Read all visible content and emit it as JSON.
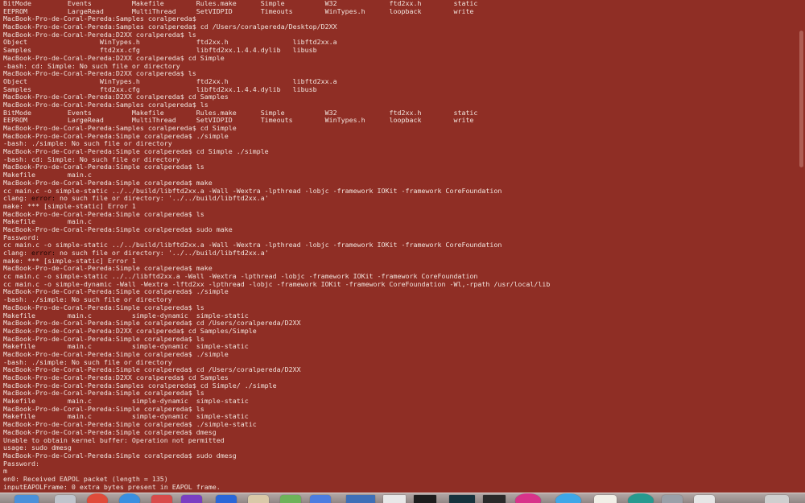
{
  "terminal": {
    "lines": [
      {
        "segments": [
          {
            "text": "BitMode         Events          Makefile        Rules.make      Simple          W32             ftd2xx.h        static"
          }
        ]
      },
      {
        "segments": [
          {
            "text": "EEPROM          LargeRead       MultiThread     SetVIDPID       Timeouts        WinTypes.h      loopback        write"
          }
        ]
      },
      {
        "segments": [
          {
            "text": "MacBook-Pro-de-Coral-Pereda:Samples coralpereda$"
          }
        ]
      },
      {
        "segments": [
          {
            "text": "MacBook-Pro-de-Coral-Pereda:Samples coralpereda$ cd /Users/coralpereda/Desktop/D2XX"
          }
        ]
      },
      {
        "segments": [
          {
            "text": "MacBook-Pro-de-Coral-Pereda:D2XX coralpereda$ ls"
          }
        ]
      },
      {
        "segments": [
          {
            "text": "Object                  WinTypes.h              ftd2xx.h                libftd2xx.a"
          }
        ]
      },
      {
        "segments": [
          {
            "text": "Samples                 ftd2xx.cfg              libftd2xx.1.4.4.dylib   libusb"
          }
        ]
      },
      {
        "segments": [
          {
            "text": "MacBook-Pro-de-Coral-Pereda:D2XX coralpereda$ cd Simple"
          }
        ]
      },
      {
        "segments": [
          {
            "text": "-bash: cd: Simple: No such file or directory"
          }
        ]
      },
      {
        "segments": [
          {
            "text": "MacBook-Pro-de-Coral-Pereda:D2XX coralpereda$ ls"
          }
        ]
      },
      {
        "segments": [
          {
            "text": "Object                  WinTypes.h              ftd2xx.h                libftd2xx.a"
          }
        ]
      },
      {
        "segments": [
          {
            "text": "Samples                 ftd2xx.cfg              libftd2xx.1.4.4.dylib   libusb"
          }
        ]
      },
      {
        "segments": [
          {
            "text": "MacBook-Pro-de-Coral-Pereda:D2XX coralpereda$ cd Samples"
          }
        ]
      },
      {
        "segments": [
          {
            "text": "MacBook-Pro-de-Coral-Pereda:Samples coralpereda$ ls"
          }
        ]
      },
      {
        "segments": [
          {
            "text": "BitMode         Events          Makefile        Rules.make      Simple          W32             ftd2xx.h        static"
          }
        ]
      },
      {
        "segments": [
          {
            "text": "EEPROM          LargeRead       MultiThread     SetVIDPID       Timeouts        WinTypes.h      loopback        write"
          }
        ]
      },
      {
        "segments": [
          {
            "text": "MacBook-Pro-de-Coral-Pereda:Samples coralpereda$ cd Simple"
          }
        ]
      },
      {
        "segments": [
          {
            "text": "MacBook-Pro-de-Coral-Pereda:Simple coralpereda$ ./simple"
          }
        ]
      },
      {
        "segments": [
          {
            "text": "-bash: ./simple: No such file or directory"
          }
        ]
      },
      {
        "segments": [
          {
            "text": "MacBook-Pro-de-Coral-Pereda:Simple coralpereda$ cd Simple ./simple"
          }
        ]
      },
      {
        "segments": [
          {
            "text": "-bash: cd: Simple: No such file or directory"
          }
        ]
      },
      {
        "segments": [
          {
            "text": "MacBook-Pro-de-Coral-Pereda:Simple coralpereda$ ls"
          }
        ]
      },
      {
        "segments": [
          {
            "text": "Makefile        main.c"
          }
        ]
      },
      {
        "segments": [
          {
            "text": "MacBook-Pro-de-Coral-Pereda:Simple coralpereda$ make"
          }
        ]
      },
      {
        "segments": [
          {
            "text": "cc main.c -o simple-static ../../build/libftd2xx.a -Wall -Wextra -lpthread -lobjc -framework IOKit -framework CoreFoundation"
          }
        ]
      },
      {
        "segments": [
          {
            "text": "clang: "
          },
          {
            "text": "error:",
            "err": true
          },
          {
            "text": " no such file or directory: '../../build/libftd2xx.a'"
          }
        ]
      },
      {
        "segments": [
          {
            "text": "make: *** [simple-static] Error 1"
          }
        ]
      },
      {
        "segments": [
          {
            "text": "MacBook-Pro-de-Coral-Pereda:Simple coralpereda$ ls"
          }
        ]
      },
      {
        "segments": [
          {
            "text": "Makefile        main.c"
          }
        ]
      },
      {
        "segments": [
          {
            "text": "MacBook-Pro-de-Coral-Pereda:Simple coralpereda$ sudo make"
          }
        ]
      },
      {
        "segments": [
          {
            "text": "Password:"
          }
        ]
      },
      {
        "segments": [
          {
            "text": "cc main.c -o simple-static ../../build/libftd2xx.a -Wall -Wextra -lpthread -lobjc -framework IOKit -framework CoreFoundation"
          }
        ]
      },
      {
        "segments": [
          {
            "text": "clang: "
          },
          {
            "text": "error:",
            "err": true
          },
          {
            "text": " no such file or directory: '../../build/libftd2xx.a'"
          }
        ]
      },
      {
        "segments": [
          {
            "text": "make: *** [simple-static] Error 1"
          }
        ]
      },
      {
        "segments": [
          {
            "text": "MacBook-Pro-de-Coral-Pereda:Simple coralpereda$ make"
          }
        ]
      },
      {
        "segments": [
          {
            "text": "cc main.c -o simple-static ../../libftd2xx.a -Wall -Wextra -lpthread -lobjc -framework IOKit -framework CoreFoundation"
          }
        ]
      },
      {
        "segments": [
          {
            "text": "cc main.c -o simple-dynamic -Wall -Wextra -lftd2xx -lpthread -lobjc -framework IOKit -framework CoreFoundation -Wl,-rpath /usr/local/lib"
          }
        ]
      },
      {
        "segments": [
          {
            "text": "MacBook-Pro-de-Coral-Pereda:Simple coralpereda$ ./simple"
          }
        ]
      },
      {
        "segments": [
          {
            "text": "-bash: ./simple: No such file or directory"
          }
        ]
      },
      {
        "segments": [
          {
            "text": "MacBook-Pro-de-Coral-Pereda:Simple coralpereda$ ls"
          }
        ]
      },
      {
        "segments": [
          {
            "text": "Makefile        main.c          simple-dynamic  simple-static"
          }
        ]
      },
      {
        "segments": [
          {
            "text": "MacBook-Pro-de-Coral-Pereda:Simple coralpereda$ cd /Users/coralpereda/D2XX"
          }
        ]
      },
      {
        "segments": [
          {
            "text": "MacBook-Pro-de-Coral-Pereda:D2XX coralpereda$ cd Samples/Simple"
          }
        ]
      },
      {
        "segments": [
          {
            "text": "MacBook-Pro-de-Coral-Pereda:Simple coralpereda$ ls"
          }
        ]
      },
      {
        "segments": [
          {
            "text": "Makefile        main.c          simple-dynamic  simple-static"
          }
        ]
      },
      {
        "segments": [
          {
            "text": "MacBook-Pro-de-Coral-Pereda:Simple coralpereda$ ./simple"
          }
        ]
      },
      {
        "segments": [
          {
            "text": "-bash: ./simple: No such file or directory"
          }
        ]
      },
      {
        "segments": [
          {
            "text": "MacBook-Pro-de-Coral-Pereda:Simple coralpereda$ cd /Users/coralpereda/D2XX"
          }
        ]
      },
      {
        "segments": [
          {
            "text": "MacBook-Pro-de-Coral-Pereda:D2XX coralpereda$ cd Samples"
          }
        ]
      },
      {
        "segments": [
          {
            "text": "MacBook-Pro-de-Coral-Pereda:Samples coralpereda$ cd Simple/ ./simple"
          }
        ]
      },
      {
        "segments": [
          {
            "text": "MacBook-Pro-de-Coral-Pereda:Simple coralpereda$ ls"
          }
        ]
      },
      {
        "segments": [
          {
            "text": "Makefile        main.c          simple-dynamic  simple-static"
          }
        ]
      },
      {
        "segments": [
          {
            "text": "MacBook-Pro-de-Coral-Pereda:Simple coralpereda$ ls"
          }
        ]
      },
      {
        "segments": [
          {
            "text": "Makefile        main.c          simple-dynamic  simple-static"
          }
        ]
      },
      {
        "segments": [
          {
            "text": "MacBook-Pro-de-Coral-Pereda:Simple coralpereda$ ./simple-static"
          }
        ]
      },
      {
        "segments": [
          {
            "text": "MacBook-Pro-de-Coral-Pereda:Simple coralpereda$ dmesg"
          }
        ]
      },
      {
        "segments": [
          {
            "text": "Unable to obtain kernel buffer: Operation not permitted"
          }
        ]
      },
      {
        "segments": [
          {
            "text": "usage: sudo dmesg"
          }
        ]
      },
      {
        "segments": [
          {
            "text": "MacBook-Pro-de-Coral-Pereda:Simple coralpereda$ sudo dmesg"
          }
        ]
      },
      {
        "segments": [
          {
            "text": "Password:"
          }
        ]
      },
      {
        "segments": [
          {
            "text": "m"
          }
        ]
      },
      {
        "segments": [
          {
            "text": "en0: Received EAPOL packet (length = 135)"
          }
        ]
      },
      {
        "segments": [
          {
            "text": "inputEAPOLFrame: 0 extra bytes present in EAPOL frame."
          }
        ]
      }
    ]
  },
  "colors": {
    "background": "#8f2e25",
    "text": "#f1e4dd",
    "error_keyword": "#1a0503"
  },
  "dock": {
    "icons": [
      {
        "name": "finder-icon",
        "color": "#4a90d9"
      },
      {
        "name": "launchpad-icon",
        "color": "#c0c4cc"
      },
      {
        "name": "chrome-icon",
        "color": "#e04b3a"
      },
      {
        "name": "safari-icon",
        "color": "#3a8fe0"
      },
      {
        "name": "messages-icon",
        "color": "#d84b4b"
      },
      {
        "name": "photos-icon",
        "color": "#7a3fc2"
      },
      {
        "name": "app-store-icon",
        "color": "#2a67d8"
      },
      {
        "name": "contacts-icon",
        "color": "#d9c9a8"
      },
      {
        "name": "maps-icon",
        "color": "#6db35a"
      },
      {
        "name": "itunes-icon",
        "color": "#4c7de0"
      },
      {
        "name": "preview-icon",
        "color": "#3e6fb7"
      },
      {
        "name": "terminal-window-icon",
        "color": "#e8e8e8"
      },
      {
        "name": "activity-monitor-icon",
        "color": "#1d1d1d"
      },
      {
        "name": "xcode-window-icon",
        "color": "#16333d"
      },
      {
        "name": "console-icon",
        "color": "#2a2a2a"
      },
      {
        "name": "creative-cloud-icon",
        "color": "#d8338a"
      },
      {
        "name": "app-icon",
        "color": "#3fa7e8"
      },
      {
        "name": "notes-icon",
        "color": "#f1efe7"
      },
      {
        "name": "teal-app-icon",
        "color": "#279a8f"
      },
      {
        "name": "system-preferences-icon",
        "color": "#9aa0a8"
      },
      {
        "name": "documents-folder-icon",
        "color": "#e6e6e6"
      },
      {
        "name": "trash-icon",
        "color": "#cfcfcf"
      }
    ]
  }
}
